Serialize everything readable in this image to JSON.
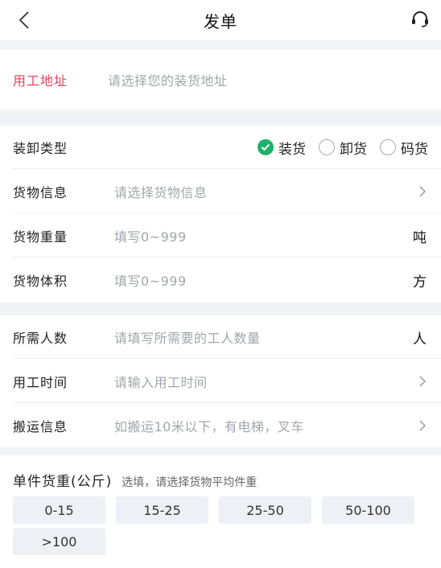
{
  "header": {
    "title": "发单"
  },
  "address": {
    "label": "用工地址",
    "placeholder": "请选择您的装货地址"
  },
  "load_type": {
    "label": "装卸类型",
    "options": [
      {
        "label": "装货",
        "checked": true
      },
      {
        "label": "卸货",
        "checked": false
      },
      {
        "label": "码货",
        "checked": false
      }
    ]
  },
  "cargo_info": {
    "label": "货物信息",
    "placeholder": "请选择货物信息"
  },
  "cargo_weight": {
    "label": "货物重量",
    "placeholder": "填写0~999",
    "unit": "吨"
  },
  "cargo_volume": {
    "label": "货物体积",
    "placeholder": "填写0~999",
    "unit": "方"
  },
  "workers": {
    "label": "所需人数",
    "placeholder": "请填写所需要的工人数量",
    "unit": "人"
  },
  "work_time": {
    "label": "用工时间",
    "placeholder": "请输入用工时间"
  },
  "transport": {
    "label": "搬运信息",
    "placeholder": "如搬运10米以下，有电梯，叉车"
  },
  "piece_weight": {
    "title": "单件货重(公斤)",
    "hint": "选填，请选择货物平均件重",
    "options": [
      "0-15",
      "15-25",
      "25-50",
      "50-100",
      ">100"
    ]
  },
  "colors": {
    "accent_pink": "#e2435f",
    "checked_green": "#1fb26b"
  }
}
